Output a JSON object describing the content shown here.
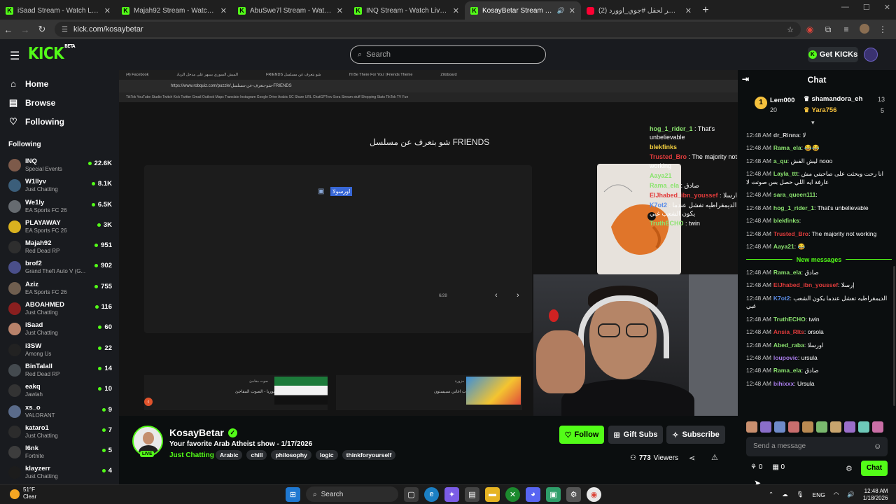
{
  "browser": {
    "tabs": [
      {
        "label": "iSaad Stream - Watch Live on K",
        "icon": "kick-favicon",
        "active": false
      },
      {
        "label": "Majah92 Stream - Watch Live o",
        "icon": "kick-favicon",
        "active": false
      },
      {
        "label": "AbuSwe7l Stream - Watch Live",
        "icon": "kick-favicon",
        "active": false
      },
      {
        "label": "INQ Stream - Watch Live on Kic",
        "icon": "kick-favicon",
        "active": false
      },
      {
        "label": "KosayBetar Stream - Watch",
        "icon": "kick-favicon",
        "active": true
      },
      {
        "label": "(2) البث المباشر لحفل #جوي_أوورد",
        "icon": "youtube-favicon",
        "active": false
      }
    ],
    "url": "kick.com/kosaybetar",
    "new_tab": "+"
  },
  "kick": {
    "logo": "KICK",
    "logo_sup": "BETA",
    "search_placeholder": "Search",
    "get_kicks": "Get KICKs"
  },
  "sidebar": {
    "nav": [
      {
        "label": "Home",
        "icon": "home-icon"
      },
      {
        "label": "Browse",
        "icon": "browse-icon"
      },
      {
        "label": "Following",
        "icon": "heart-icon"
      }
    ],
    "following_title": "Following",
    "following": [
      {
        "name": "INQ",
        "category": "Special Events",
        "viewers": "22.6K",
        "color": "#7d5a4a"
      },
      {
        "name": "W1llyv",
        "category": "Just Chatting",
        "viewers": "8.1K",
        "color": "#3b5e7a"
      },
      {
        "name": "We1ly",
        "category": "EA Sports FC 26",
        "viewers": "6.5K",
        "color": "#666b70"
      },
      {
        "name": "PLAYAWAY",
        "category": "EA Sports FC 26",
        "viewers": "3K",
        "color": "#d9b21f"
      },
      {
        "name": "Majah92",
        "category": "Red Dead RP",
        "viewers": "951",
        "color": "#2e2e2e"
      },
      {
        "name": "brof2",
        "category": "Grand Theft Auto V (G...",
        "viewers": "902",
        "color": "#4a4f8a"
      },
      {
        "name": "Aziz",
        "category": "EA Sports FC 26",
        "viewers": "755",
        "color": "#6f5e4f"
      },
      {
        "name": "ABOAHMED",
        "category": "Just Chatting",
        "viewers": "116",
        "color": "#8a1f1f"
      },
      {
        "name": "iSaad",
        "category": "Just Chatting",
        "viewers": "60",
        "color": "#b8826a"
      },
      {
        "name": "i3SW",
        "category": "Among Us",
        "viewers": "22",
        "color": "#222222"
      },
      {
        "name": "BinTalall",
        "category": "Red Dead RP",
        "viewers": "14",
        "color": "#444a4f"
      },
      {
        "name": "eakq",
        "category": "Jawlah",
        "viewers": "10",
        "color": "#333333"
      },
      {
        "name": "xs_o",
        "category": "VALORANT",
        "viewers": "9",
        "color": "#5a6b8a"
      },
      {
        "name": "kataro1",
        "category": "Just Chatting",
        "viewers": "7",
        "color": "#2c2c2c"
      },
      {
        "name": "l6nk",
        "category": "Fortnite",
        "viewers": "5",
        "color": "#3d3d3d"
      },
      {
        "name": "klayzerr",
        "category": "Just Chatting",
        "viewers": "4",
        "color": "#1c1c1c"
      }
    ]
  },
  "stream": {
    "inner_tabs": [
      "(4) Facebook",
      "المبش السوري بسهر على مدخل الرباد",
      "FRIENDS شو بتعرف عن مسلسل",
      "I'll Be There For You' (Friends Theme",
      "Zitoboard"
    ],
    "inner_url": "https://www.robquiz.com/puzzle/شو-بتعرف-عن-مسلسل-FRIENDS",
    "inner_bookmarks": "TikTok   YouTube   Studio   Twitch   Kick   Twitter   Gmail   Outlook   Maps   Translate   Instagram   Google Drive   Arabic   SC   Share   URL   ChatGPTrev   Sora   Stream stuff   Shopping   Stats   TikTok   TV   Fun",
    "quiz_title": "شو بتعرف عن مسلسل FRIENDS",
    "quiz_answer": "اورسولا",
    "quiz_page": "6/28",
    "thumb1_title": "صوت مفاجئ",
    "thumb1_desc": "فطاين سوريا - الصوت المفاجئ",
    "thumb2_title": "حزورة",
    "thumb2_desc": "اكمل كلمات اغاني سبيستون",
    "overlay_chat": [
      {
        "user": "hog_1_rider_1",
        "text": "That's unbelievable",
        "color": "#8be36f"
      },
      {
        "user": "blekfinks",
        "text": "",
        "color": "#f4d03f"
      },
      {
        "user": "Trusted_Bro",
        "text": "The majority not working",
        "color": "#e23c3c"
      },
      {
        "user": "Aaya21",
        "text": "",
        "color": "#8be36f"
      },
      {
        "user": "Rama_ela",
        "text": "صادق",
        "color": "#8be36f"
      },
      {
        "user": "ElJhabed_ibn_youssef",
        "text": "ارسلا",
        "color": "#e23c3c"
      },
      {
        "user": "K7ot2",
        "text": "الديمقراطيه تفشل عندما يكون الشعب غبي",
        "color": "#5b8de8"
      },
      {
        "user": "TruthECHO",
        "text": "twin",
        "color": "#8be36f"
      }
    ]
  },
  "channel": {
    "name": "KosayBetar",
    "live": "LIVE",
    "title": "Your favorite Arab Atheist show - 1/17/2026",
    "category": "Just Chatting",
    "tags": [
      "Arabic",
      "chill",
      "philosophy",
      "logic",
      "thinkforyourself"
    ],
    "follow": "Follow",
    "gift_subs": "Gift Subs",
    "subscribe": "Subscribe",
    "viewers_count": "773",
    "viewers_label": "Viewers"
  },
  "chat": {
    "title": "Chat",
    "leaderboard": {
      "rank": "1",
      "top_user": "Lem000",
      "top_value": "20",
      "users": [
        {
          "name": "shamandora_eh",
          "value": "13"
        },
        {
          "name": "Yara756",
          "value": "5"
        }
      ]
    },
    "messages": [
      {
        "ts": "12:48 AM",
        "user": "dr_Rinna",
        "text": "لا",
        "color": "#cfcfcf"
      },
      {
        "ts": "12:48 AM",
        "user": "Rama_ela",
        "text": "😂😂",
        "color": "#8be36f"
      },
      {
        "ts": "12:48 AM",
        "user": "a_qu",
        "text": "ليش الفش nooo",
        "color": "#8be36f"
      },
      {
        "ts": "12:48 AM",
        "user": "Layla_ttt",
        "text": "انا رحت وبحثت على صاحبتي مش عارفة ايه اللي حصل بس صوتت لا",
        "color": "#8be36f"
      },
      {
        "ts": "12:48 AM",
        "user": "sara_queen111",
        "text": "",
        "color": "#8be36f"
      },
      {
        "ts": "12:48 AM",
        "user": "hog_1_rider_1",
        "text": "That's unbelievable",
        "color": "#8be36f"
      },
      {
        "ts": "12:48 AM",
        "user": "blekfinks",
        "text": "",
        "color": "#8be36f"
      },
      {
        "ts": "12:48 AM",
        "user": "Trusted_Bro",
        "text": "The majority not working",
        "color": "#e23c3c"
      },
      {
        "ts": "12:48 AM",
        "user": "Aaya21",
        "text": "😂",
        "color": "#8be36f"
      }
    ],
    "new_messages": "New messages",
    "new": [
      {
        "ts": "12:48 AM",
        "user": "Rama_ela",
        "text": "صادق",
        "color": "#8be36f"
      },
      {
        "ts": "12:48 AM",
        "user": "ElJhabed_ibn_youssef",
        "text": "إرسلا",
        "color": "#e23c3c"
      },
      {
        "ts": "12:48 AM",
        "user": "K7ot2",
        "text": "الديمقراطيه تفشل عندما يكون الشعب غبي",
        "color": "#5b8de8"
      },
      {
        "ts": "12:48 AM",
        "user": "TruthECHO",
        "text": "twin",
        "color": "#8be36f"
      },
      {
        "ts": "12:48 AM",
        "user": "Ansia_Rlts",
        "text": "orsola",
        "color": "#e23c3c"
      },
      {
        "ts": "12:48 AM",
        "user": "Abed_raba",
        "text": "اورسلا",
        "color": "#8be36f"
      },
      {
        "ts": "12:48 AM",
        "user": "loupovic",
        "text": "ursula",
        "color": "#a77be8"
      },
      {
        "ts": "12:48 AM",
        "user": "Rama_ela",
        "text": "صادق",
        "color": "#8be36f"
      },
      {
        "ts": "12:48 AM",
        "user": "bihixxx",
        "text": "Ursula",
        "color": "#a77be8"
      }
    ],
    "input_placeholder": "Send a message",
    "kicks_count": "0",
    "points_count": "0",
    "send": "Chat"
  },
  "taskbar": {
    "weather_temp": "51°F",
    "weather_desc": "Clear",
    "search": "Search",
    "lang": "ENG",
    "time": "12:48 AM",
    "date": "1/18/2026"
  },
  "colors": {
    "kick_green": "#53fc18",
    "bg": "#0b0e0f",
    "panel": "#191b1f"
  }
}
